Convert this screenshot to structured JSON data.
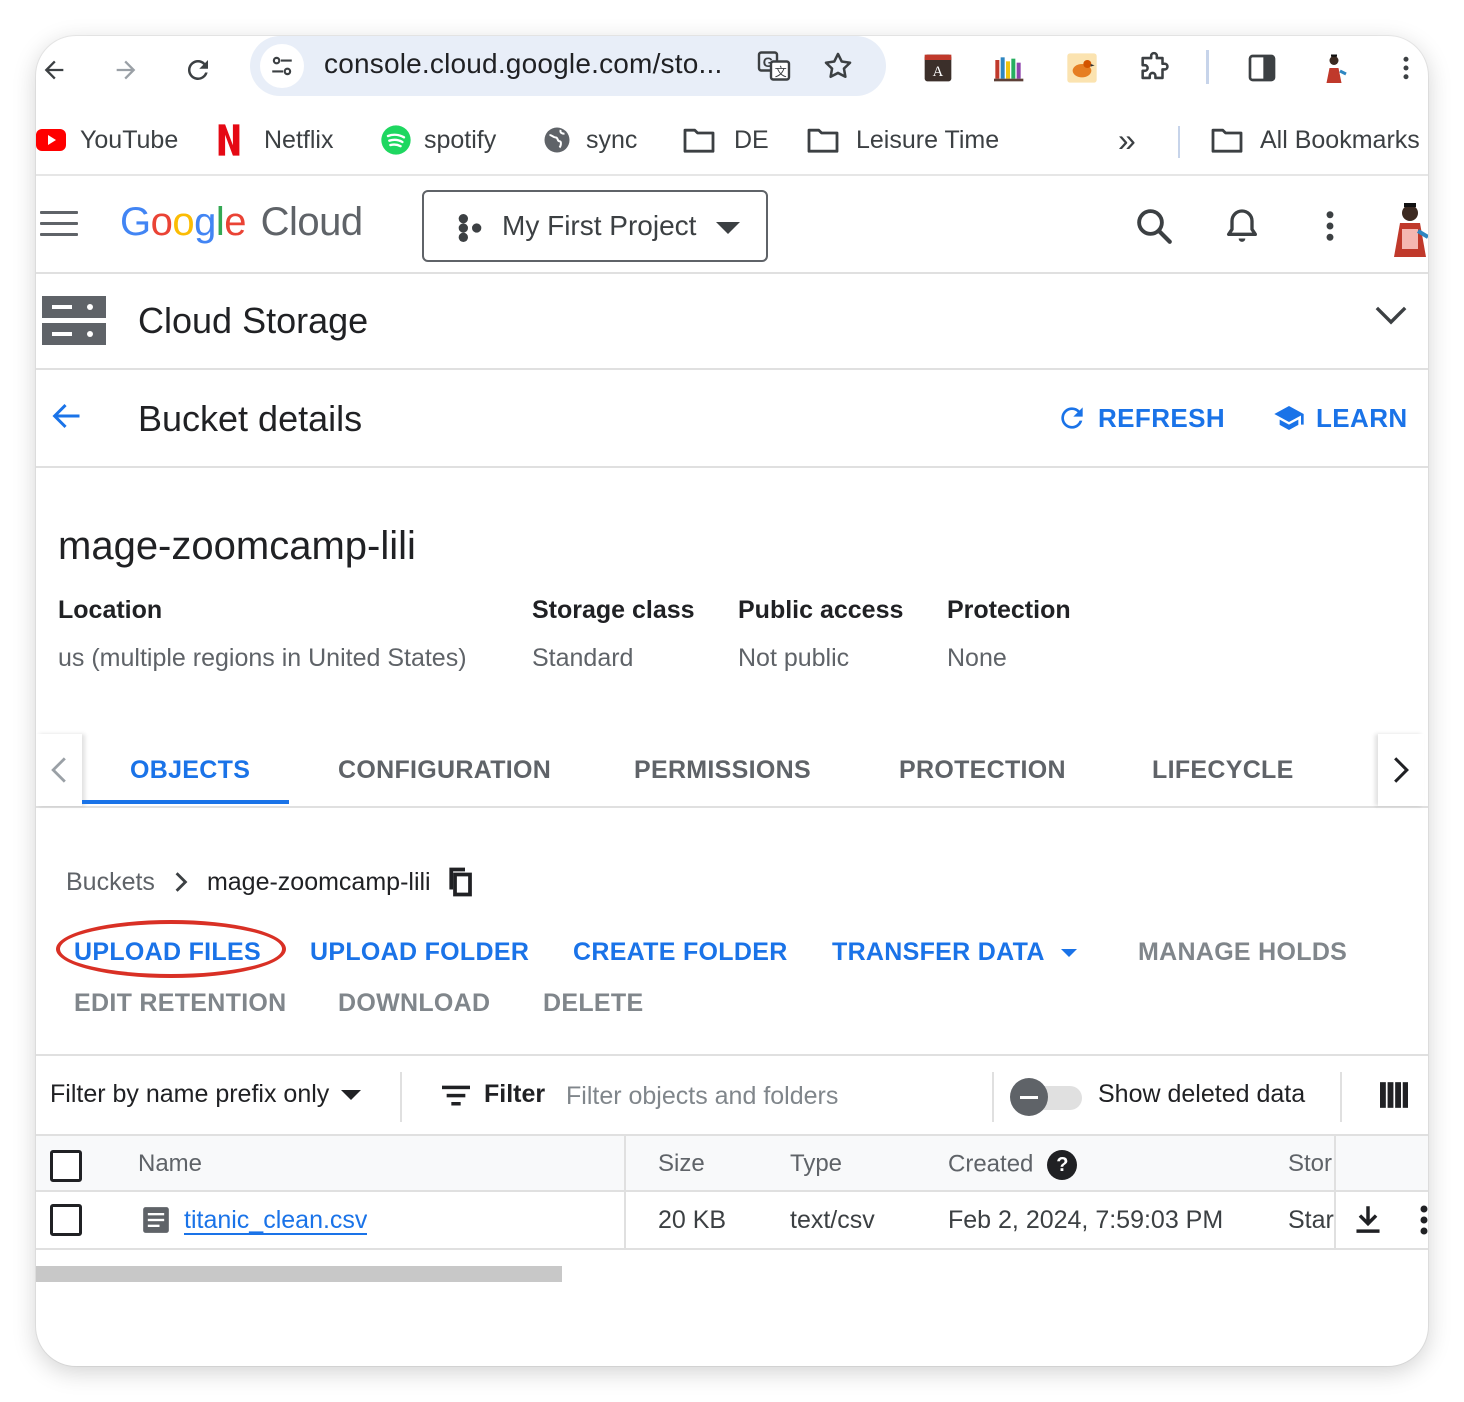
{
  "browser": {
    "url": "console.cloud.google.com/sto...",
    "bookmarks": [
      {
        "label": "YouTube",
        "icon": "youtube-icon"
      },
      {
        "label": "Netflix",
        "icon": "netflix-icon"
      },
      {
        "label": "spotify",
        "icon": "spotify-icon"
      },
      {
        "label": "sync",
        "icon": "globe-icon"
      },
      {
        "label": "DE",
        "icon": "folder-icon"
      },
      {
        "label": "Leisure Time",
        "icon": "folder-icon"
      }
    ],
    "overflow_label": "»",
    "all_bookmarks_label": "All Bookmarks"
  },
  "header": {
    "logo_google": "Google",
    "logo_cloud": "Cloud",
    "project": "My First Project"
  },
  "product": {
    "title": "Cloud Storage"
  },
  "page": {
    "title": "Bucket details",
    "refresh_label": "REFRESH",
    "learn_label": "LEARN"
  },
  "bucket": {
    "name": "mage-zoomcamp-lili",
    "properties": [
      {
        "label": "Location",
        "value": "us (multiple regions in United States)"
      },
      {
        "label": "Storage class",
        "value": "Standard"
      },
      {
        "label": "Public access",
        "value": "Not public"
      },
      {
        "label": "Protection",
        "value": "None"
      }
    ]
  },
  "tabs": [
    "OBJECTS",
    "CONFIGURATION",
    "PERMISSIONS",
    "PROTECTION",
    "LIFECYCLE"
  ],
  "breadcrumb": {
    "root": "Buckets",
    "current": "mage-zoomcamp-lili"
  },
  "actions": {
    "upload_files": "UPLOAD FILES",
    "upload_folder": "UPLOAD FOLDER",
    "create_folder": "CREATE FOLDER",
    "transfer_data": "TRANSFER DATA",
    "manage_holds": "MANAGE HOLDS",
    "edit_retention": "EDIT RETENTION",
    "download": "DOWNLOAD",
    "delete": "DELETE"
  },
  "filter": {
    "mode": "Filter by name prefix only",
    "filter_label": "Filter",
    "placeholder": "Filter objects and folders",
    "show_deleted_label": "Show deleted data"
  },
  "table": {
    "columns": [
      "Name",
      "Size",
      "Type",
      "Created",
      "Stor"
    ],
    "rows": [
      {
        "name": "titanic_clean.csv",
        "size": "20 KB",
        "type": "text/csv",
        "created": "Feb 2, 2024, 7:59:03 PM",
        "storage": "Star"
      }
    ]
  },
  "colors": {
    "accent": "#1a73e8",
    "annotation": "#d93025"
  }
}
